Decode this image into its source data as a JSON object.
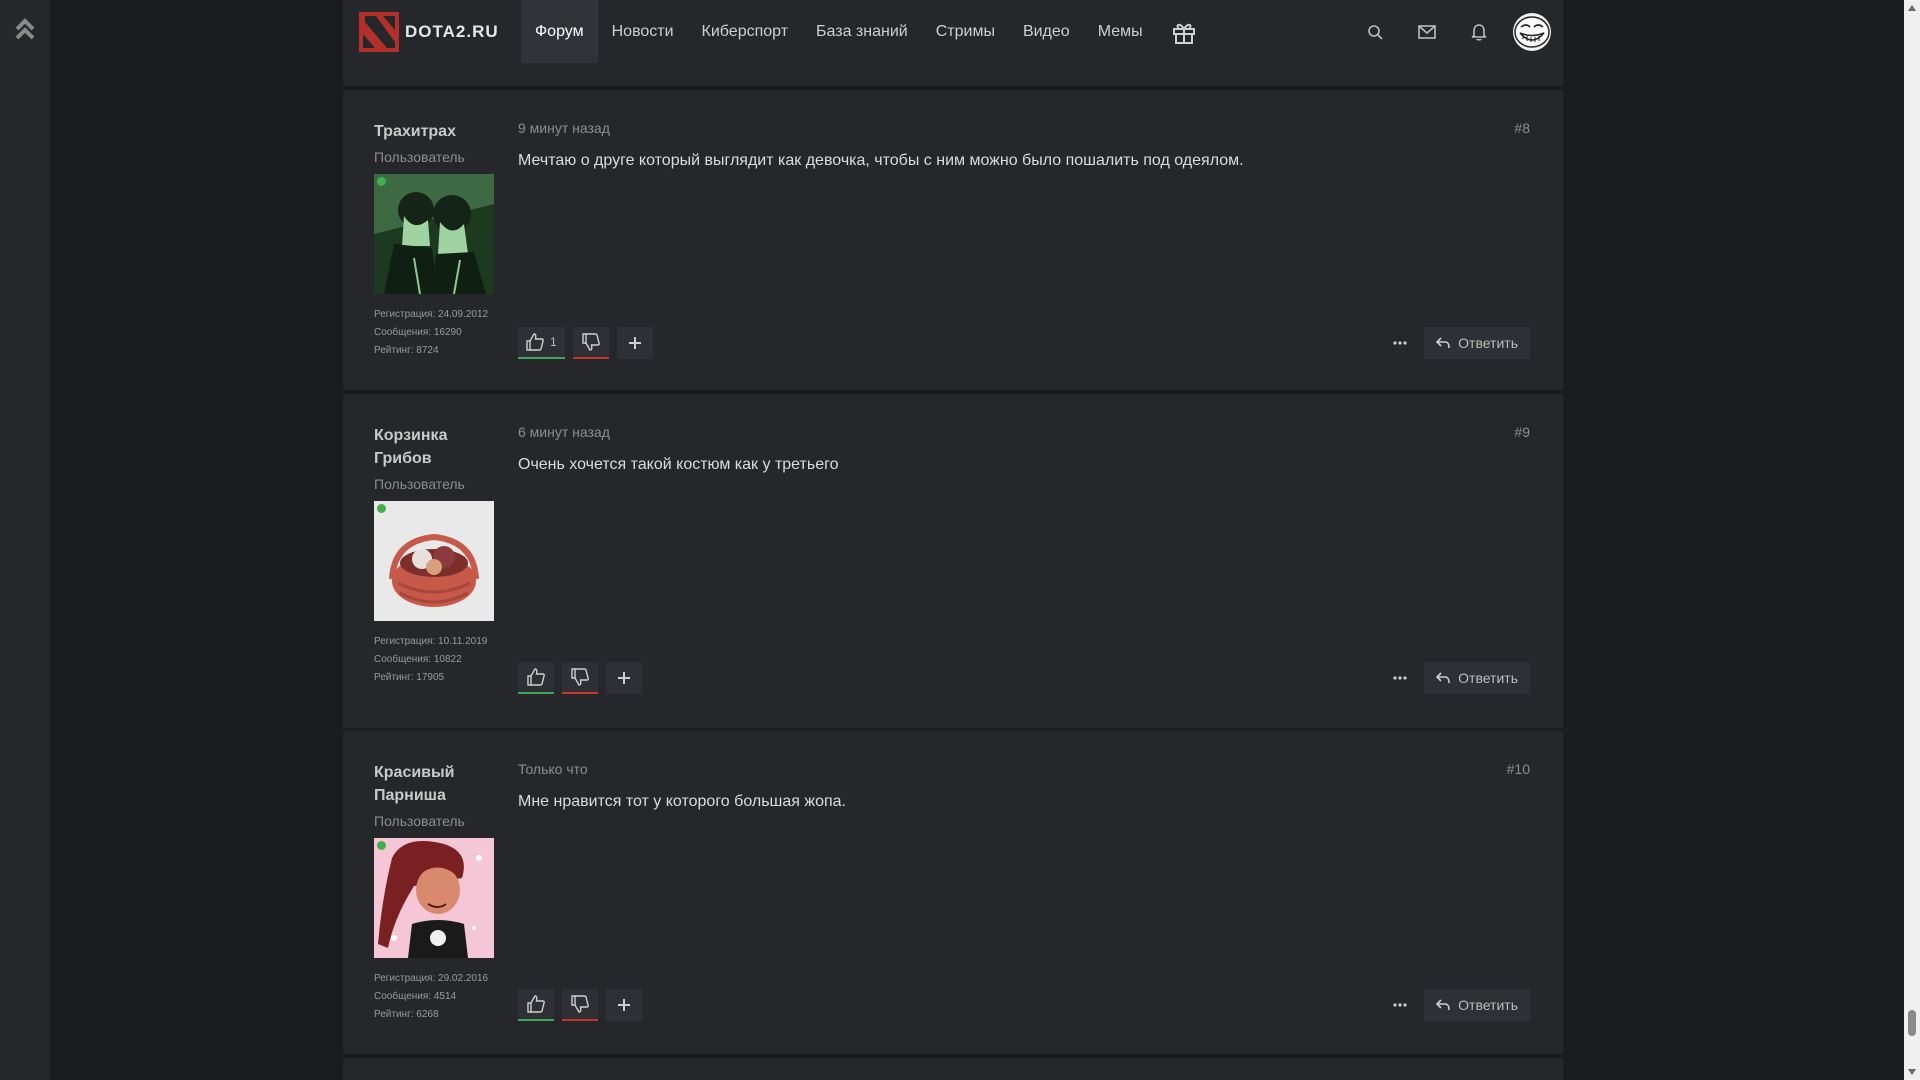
{
  "header": {
    "logo_text": "DOTA2.RU",
    "nav": [
      "Форум",
      "Новости",
      "Киберспорт",
      "База знаний",
      "Стримы",
      "Видео",
      "Мемы"
    ],
    "active_nav": "Форум"
  },
  "icons": {
    "rail": "double-chevron-up-icon",
    "gift": "gift-icon",
    "search": "search-icon",
    "mail": "mail-icon",
    "bell": "bell-icon",
    "avatar": "trollface-avatar",
    "like": "thumbs-up-icon",
    "dislike": "thumbs-down-icon",
    "plus": "plus-icon",
    "more": "more-dots-icon",
    "reply": "reply-arrow-icon"
  },
  "colors": {
    "background": "#1b1c1f",
    "panel": "#26272b",
    "like_underline": "#3fa55a",
    "dislike_underline": "#c0392b",
    "online": "#3fb04a",
    "logo_red": "#c8372d"
  },
  "reply_label": "Ответить",
  "posts": [
    {
      "author": "Трахитрах",
      "role": "Пользователь",
      "reg": "Регистрация: 24.09.2012",
      "messages": "Сообщения: 16290",
      "rating": "Рейтинг: 8724",
      "time": "9 минут назад",
      "num": "#8",
      "text": "Мечтаю о друге который выглядит как девочка, чтобы с ним можно было пошалить под одеялом.",
      "likes": "1"
    },
    {
      "author": "Корзинка Грибов",
      "role": "Пользователь",
      "reg": "Регистрация: 10.11.2019",
      "messages": "Сообщения: 10822",
      "rating": "Рейтинг: 17905",
      "time": "6 минут назад",
      "num": "#9",
      "text": "Очень хочется такой костюм как у третьего",
      "likes": ""
    },
    {
      "author": "Красивый Парниша",
      "role": "Пользователь",
      "reg": "Регистрация: 29.02.2016",
      "messages": "Сообщения: 4514",
      "rating": "Рейтинг: 6268",
      "time": "Только что",
      "num": "#10",
      "text": "Мне нравится тот у которого большая жопа.",
      "likes": ""
    }
  ]
}
